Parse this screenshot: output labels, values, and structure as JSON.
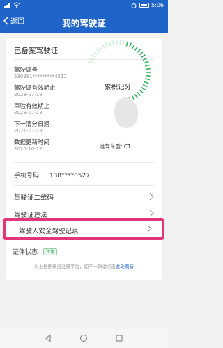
{
  "status_bar": {
    "carrier": "ill",
    "time": "5:06"
  },
  "header": {
    "back_label": "返回",
    "title": "我的驾驶证"
  },
  "card": {
    "section_title": "已备案驾驶证",
    "fields": [
      {
        "label": "驾驶证号",
        "value": "530381*********4512"
      },
      {
        "label": "驾驶证有效期止",
        "value": "2023-07-18"
      },
      {
        "label": "审验有效期止",
        "value": "2023-07-18"
      },
      {
        "label": "下一清分日期",
        "value": "2021-07-18"
      },
      {
        "label": "数据更新时间",
        "value": "2020-10-22"
      }
    ],
    "score_label": "累积记分",
    "car_type": "准驾车型: C1",
    "phone_label": "手机号码",
    "phone_value": "138****0527",
    "menu": [
      {
        "label": "驾驶证二维码"
      },
      {
        "label": "驾驶证违法"
      }
    ],
    "highlighted_item": {
      "label": "驾驶人安全驾驶记录"
    },
    "status_label": "证件状态",
    "status_badge": "正常"
  },
  "footnote": {
    "text": "以上数据来自注册平台，如不一致请点击",
    "link": "此处刷新"
  },
  "colors": {
    "primary": "#1f64c8",
    "highlight_border": "#e2357a",
    "gauge": "#2cb45a",
    "badge_green": "#2e9d4f"
  },
  "icons": {
    "back": "chevron-left-icon",
    "chevron": "chevron-right-icon",
    "nav_back": "triangle-back-icon",
    "nav_home": "circle-home-icon",
    "nav_recent": "square-recent-icon"
  }
}
